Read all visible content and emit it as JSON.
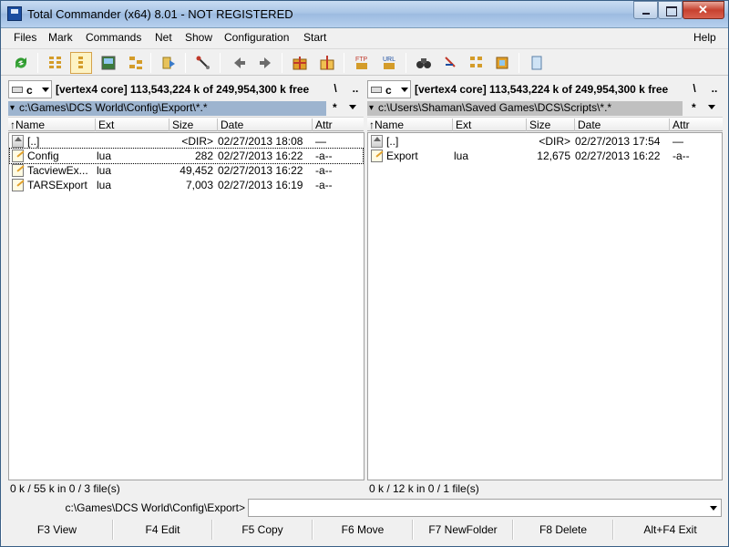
{
  "window": {
    "title": "Total Commander (x64) 8.01 - NOT REGISTERED"
  },
  "menu": {
    "files": {
      "label": "Files"
    },
    "mark": {
      "label": "Mark"
    },
    "commands": {
      "label": "Commands"
    },
    "net": {
      "label": "Net"
    },
    "show": {
      "label": "Show"
    },
    "configuration": {
      "label": "Configuration"
    },
    "start": {
      "label": "Start"
    },
    "help": {
      "label": "Help"
    }
  },
  "toolbar": {
    "icons": [
      "refresh-icon",
      "brief-view-icon",
      "detailed-view-icon",
      "thumbnail-view-icon",
      "tree-view-icon",
      "invert-selection-icon",
      "unpack-icon",
      "back-icon",
      "forward-icon",
      "pack-icon",
      "unpack-all-icon",
      "ftp-icon",
      "url-icon",
      "find-icon",
      "multi-rename-icon",
      "compare-dirs-icon",
      "sync-dirs-icon",
      "notepad-icon"
    ],
    "ftp_label": "FTP",
    "url_label": "URL"
  },
  "left": {
    "drive": "c",
    "drive_info": "[vertex4 core]  113,543,224 k of 249,954,300 k free",
    "root_btn": "\\",
    "up_btn": "..",
    "path": "c:\\Games\\DCS World\\Config\\Export\\*.*",
    "filter": "*",
    "columns": {
      "name": "Name",
      "ext": "Ext",
      "size": "Size",
      "date": "Date",
      "attr": "Attr"
    },
    "files": [
      {
        "name": "[..]",
        "ext": "",
        "size": "<DIR>",
        "date": "02/27/2013 18:08",
        "attr": "—",
        "icon": "up-dir"
      },
      {
        "name": "Config",
        "ext": "lua",
        "size": "282",
        "date": "02/27/2013 16:22",
        "attr": "-a--",
        "icon": "lua-file"
      },
      {
        "name": "TacviewEx...",
        "ext": "lua",
        "size": "49,452",
        "date": "02/27/2013 16:22",
        "attr": "-a--",
        "icon": "lua-file"
      },
      {
        "name": "TARSExport",
        "ext": "lua",
        "size": "7,003",
        "date": "02/27/2013 16:19",
        "attr": "-a--",
        "icon": "lua-file"
      }
    ],
    "status": "0 k / 55 k in 0 / 3 file(s)"
  },
  "right": {
    "drive": "c",
    "drive_info": "[vertex4 core]  113,543,224 k of 249,954,300 k free",
    "root_btn": "\\",
    "up_btn": "..",
    "path": "c:\\Users\\Shaman\\Saved Games\\DCS\\Scripts\\*.*",
    "filter": "*",
    "columns": {
      "name": "Name",
      "ext": "Ext",
      "size": "Size",
      "date": "Date",
      "attr": "Attr"
    },
    "files": [
      {
        "name": "[..]",
        "ext": "",
        "size": "<DIR>",
        "date": "02/27/2013 17:54",
        "attr": "—",
        "icon": "up-dir"
      },
      {
        "name": "Export",
        "ext": "lua",
        "size": "12,675",
        "date": "02/27/2013 16:22",
        "attr": "-a--",
        "icon": "lua-file"
      }
    ],
    "status": "0 k / 12 k in 0 / 1 file(s)"
  },
  "cmdline": {
    "prompt": "c:\\Games\\DCS World\\Config\\Export>",
    "value": ""
  },
  "fkeys": {
    "f3": "F3 View",
    "f4": "F4 Edit",
    "f5": "F5 Copy",
    "f6": "F6 Move",
    "f7": "F7 NewFolder",
    "f8": "F8 Delete",
    "exit": "Alt+F4 Exit"
  }
}
